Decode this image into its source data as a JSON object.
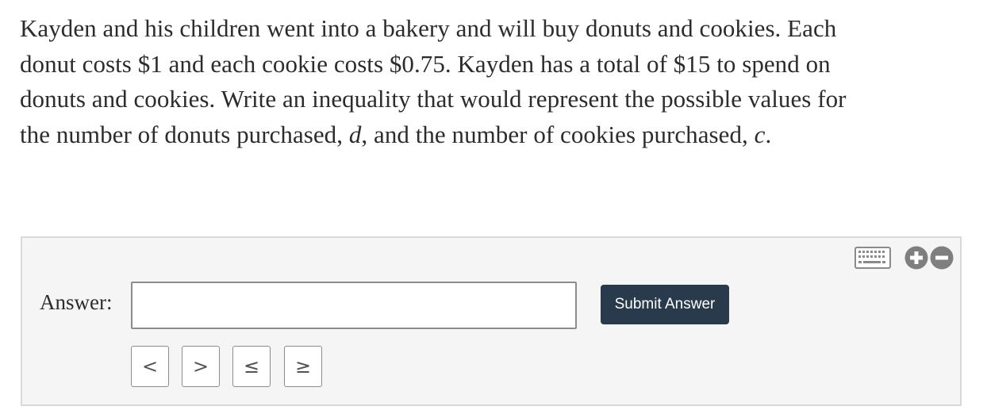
{
  "question": {
    "line1": "Kayden and his children went into a bakery and will buy donuts and cookies. Each",
    "line2": "donut costs $1 and each cookie costs $0.75. Kayden has a total of $15 to spend on",
    "line3": "donuts and cookies. Write an inequality that would represent the possible values for",
    "line4_before_d": "the number of donuts purchased, ",
    "var_d": "d",
    "line4_middle": ", and the number of cookies purchased, ",
    "var_c": "c",
    "line4_end": "."
  },
  "answer": {
    "label": "Answer:",
    "input_value": "",
    "submit_label": "Submit Answer",
    "symbols": [
      "<",
      ">",
      "≤",
      "≥"
    ]
  },
  "toolbar": {
    "keyboard_icon": "keyboard-icon",
    "zoom_in_icon": "plus-circle-icon",
    "zoom_out_icon": "minus-circle-icon"
  },
  "colors": {
    "submit_bg": "#2a3a4d",
    "panel_bg": "#f5f5f5",
    "icon_gray": "#7f7f7f"
  }
}
